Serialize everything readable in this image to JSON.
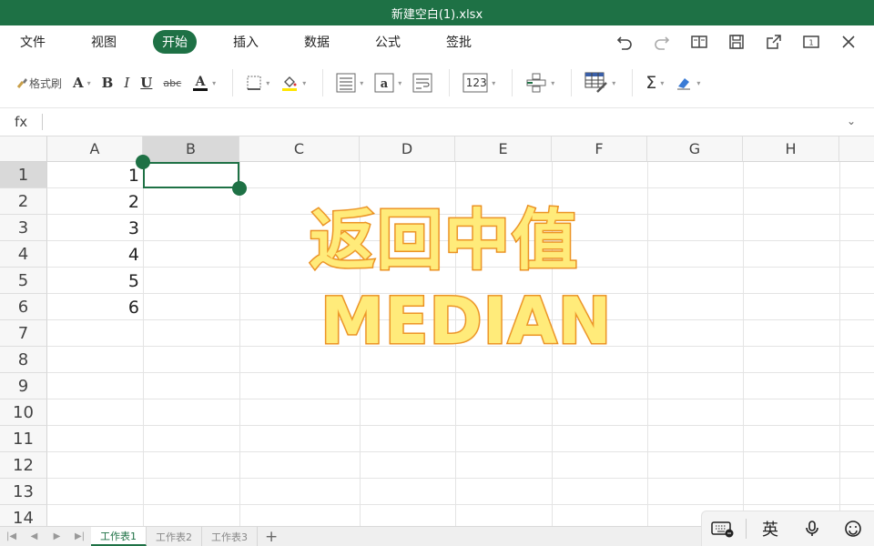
{
  "window": {
    "title": "新建空白(1).xlsx"
  },
  "menu": {
    "items": [
      "文件",
      "视图",
      "开始",
      "插入",
      "数据",
      "公式",
      "签批"
    ],
    "active_index": 2
  },
  "toolbar": {
    "format_painter_label": "格式刷",
    "font_color": "#111111",
    "fill_color": "#ffe600",
    "number_format_label": "123",
    "sum_symbol": "Σ"
  },
  "formula_bar": {
    "fx_label": "fx",
    "value": ""
  },
  "grid": {
    "columns": [
      "A",
      "B",
      "C",
      "D",
      "E",
      "F",
      "G",
      "H"
    ],
    "selected_column": "B",
    "rows": [
      "1",
      "2",
      "3",
      "4",
      "5",
      "6",
      "7",
      "8",
      "9",
      "10",
      "11",
      "12",
      "13",
      "14"
    ],
    "selected_row": "1",
    "column_a_values": [
      "1",
      "2",
      "3",
      "4",
      "5",
      "6"
    ]
  },
  "overlay": {
    "line1": "返回中值",
    "line2": "MEDIAN"
  },
  "sheets": {
    "tabs": [
      "工作表1",
      "工作表2",
      "工作表3"
    ],
    "active_index": 0,
    "add_label": "+"
  },
  "ime": {
    "lang_label": "英"
  },
  "colors": {
    "accent": "#1e7145",
    "overlay_fill": "#ffeb7a",
    "overlay_stroke": "#e88a1a"
  }
}
